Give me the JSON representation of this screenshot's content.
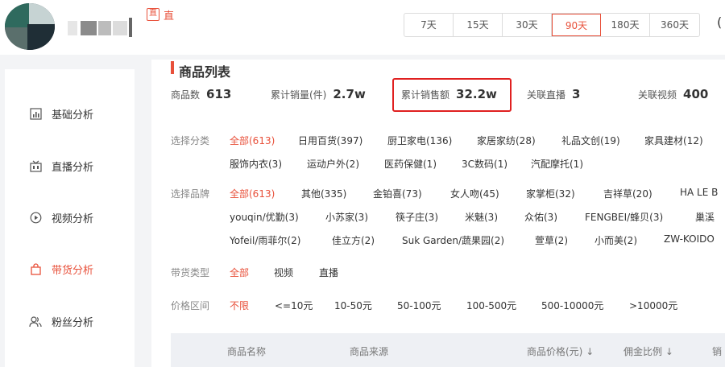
{
  "header": {
    "live_badge": "直",
    "live_text": "直",
    "date_tabs": [
      "7天",
      "15天",
      "30天",
      "90天",
      "180天",
      "360天"
    ],
    "active_date_tab": "90天",
    "right_glyph": "("
  },
  "sidebar": {
    "items": [
      {
        "label": "基础分析",
        "icon": "bar-chart-icon"
      },
      {
        "label": "直播分析",
        "icon": "live-icon"
      },
      {
        "label": "视频分析",
        "icon": "play-icon"
      },
      {
        "label": "带货分析",
        "icon": "shopping-bag-icon",
        "active": true
      },
      {
        "label": "粉丝分析",
        "icon": "user-group-icon"
      }
    ]
  },
  "main": {
    "title": "商品列表",
    "stats": {
      "products_label": "商品数",
      "products_value": "613",
      "sales_qty_label": "累计销量(件)",
      "sales_qty_value": "2.7w",
      "sales_amt_label": "累计销售额",
      "sales_amt_value": "32.2w",
      "live_label": "关联直播",
      "live_value": "3",
      "video_label": "关联视频",
      "video_value": "400"
    },
    "category": {
      "label": "选择分类",
      "row1": [
        "全部(613)",
        "日用百货(397)",
        "厨卫家电(136)",
        "家居家纺(28)",
        "礼品文创(19)",
        "家具建材(12)"
      ],
      "row2": [
        "服饰内衣(3)",
        "运动户外(2)",
        "医药保健(1)",
        "3C数码(1)",
        "汽配摩托(1)"
      ]
    },
    "brand": {
      "label": "选择品牌",
      "row1": [
        "全部(613)",
        "其他(335)",
        "金铂喜(73)",
        "女人吻(45)",
        "家掌柜(32)",
        "吉祥草(20)",
        "HA LE B"
      ],
      "row2": [
        "youqin/优勤(3)",
        "小苏家(3)",
        "筷子庄(3)",
        "米魅(3)",
        "众佑(3)",
        "FENGBEI/蜂贝(3)",
        "巢溪"
      ],
      "row3": [
        "Yofeil/雨菲尔(2)",
        "佳立方(2)",
        "Suk Garden/蔬果园(2)",
        "萱草(2)",
        "小而美(2)",
        "ZW-KOIDO"
      ]
    },
    "sale_type": {
      "label": "带货类型",
      "options": [
        "全部",
        "视频",
        "直播"
      ]
    },
    "price": {
      "label": "价格区间",
      "options": [
        "不限",
        "<=10元",
        "10-50元",
        "50-100元",
        "100-500元",
        "500-10000元",
        ">10000元"
      ]
    },
    "table": {
      "columns": [
        "商品名称",
        "商品来源",
        "商品价格(元)",
        "佣金比例",
        "销"
      ]
    }
  },
  "colors": {
    "accent": "#e8503a",
    "highlight_border": "#e02020"
  }
}
